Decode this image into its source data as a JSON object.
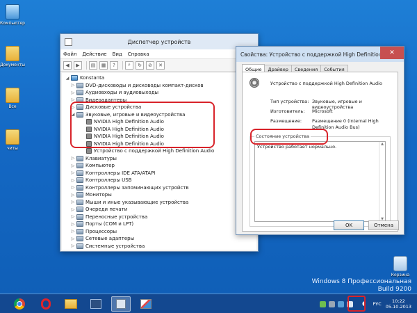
{
  "desktop": {
    "icons": [
      {
        "label": "Компьютер"
      },
      {
        "label": "Документы"
      },
      {
        "label": "Все"
      },
      {
        "label": "читы"
      }
    ],
    "recycle_bin": "Корзина",
    "watermark": {
      "line1": "Windows 8 Профессиональная",
      "line2": "Build 9200"
    }
  },
  "device_manager": {
    "title": "Диспетчер устройств",
    "menu": [
      "Файл",
      "Действие",
      "Вид",
      "Справка"
    ],
    "root": "Konstanta",
    "nodes": [
      {
        "label": "DVD-дисководы и дисководы компакт-дисков",
        "expanded": false
      },
      {
        "label": "Аудиовходы и аудиовыходы",
        "expanded": false
      },
      {
        "label": "Видеоадаптеры",
        "expanded": false
      },
      {
        "label": "Дисковые устройства",
        "expanded": false
      },
      {
        "label": "Звуковые, игровые и видеоустройства",
        "expanded": true,
        "children": [
          "NVIDIA High Definition Audio",
          "NVIDIA High Definition Audio",
          "NVIDIA High Definition Audio",
          "NVIDIA High Definition Audio",
          "Устройство с поддержкой High Definition Audio"
        ]
      },
      {
        "label": "Клавиатуры",
        "expanded": false
      },
      {
        "label": "Компьютер",
        "expanded": false
      },
      {
        "label": "Контроллеры IDE ATA/ATAPI",
        "expanded": false
      },
      {
        "label": "Контроллеры USB",
        "expanded": false
      },
      {
        "label": "Контроллеры запоминающих устройств",
        "expanded": false
      },
      {
        "label": "Мониторы",
        "expanded": false
      },
      {
        "label": "Мыши и иные указывающие устройства",
        "expanded": false
      },
      {
        "label": "Очереди печати",
        "expanded": false
      },
      {
        "label": "Переносные устройства",
        "expanded": false
      },
      {
        "label": "Порты (COM и LPT)",
        "expanded": false
      },
      {
        "label": "Процессоры",
        "expanded": false
      },
      {
        "label": "Сетевые адаптеры",
        "expanded": false
      },
      {
        "label": "Системные устройства",
        "expanded": false
      }
    ]
  },
  "properties": {
    "title": "Свойства: Устройство с поддержкой High Definition Audio",
    "tabs": [
      "Общие",
      "Драйвер",
      "Сведения",
      "События"
    ],
    "device_name": "Устройство с поддержкой High Definition Audio",
    "type_label": "Тип устройства:",
    "type_value": "Звуковые, игровые и видеоустройства",
    "maker_label": "Изготовитель:",
    "maker_value": "Microsoft",
    "location_label": "Размещение:",
    "location_value": "Размещение 0 (Internal High Definition Audio Bus)",
    "status_group": "Состояние устройства",
    "status_text": "Устройство работает нормально.",
    "ok": "OK",
    "cancel": "Отмена"
  },
  "taskbar": {
    "lang": "РУС",
    "time": "10:22",
    "date": "05.10.2013"
  },
  "colors": {
    "highlight": "#d8232a",
    "accent": "#1468c4"
  }
}
